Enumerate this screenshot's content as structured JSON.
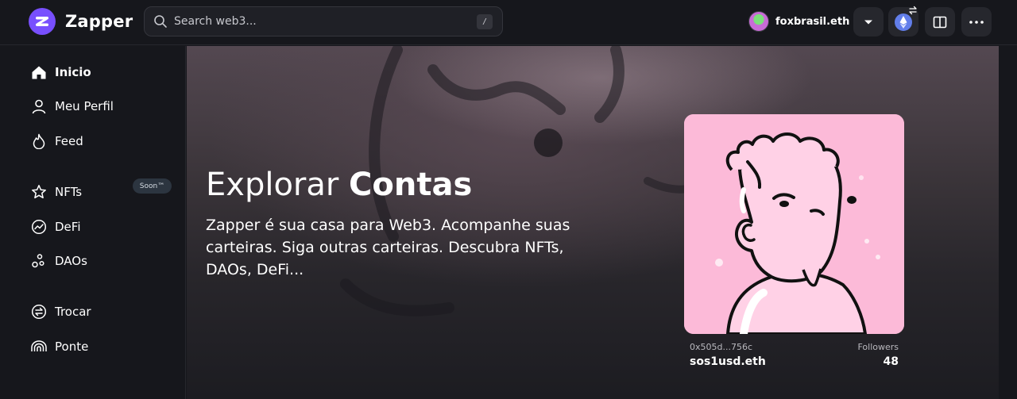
{
  "brand": {
    "name": "Zapper",
    "accent": "#784ffe"
  },
  "search": {
    "placeholder": "Search web3...",
    "shortcut": "/"
  },
  "account": {
    "name": "foxbrasil.eth"
  },
  "toolbar": {
    "dropdown_icon": "chevron-down-icon",
    "network_icon": "ethereum-icon",
    "panel_icon": "book-open-icon",
    "more_icon": "more-horizontal-icon"
  },
  "sidebar": {
    "items": [
      {
        "label": "Inicio",
        "icon": "home-icon",
        "active": true
      },
      {
        "label": "Meu Perfil",
        "icon": "user-icon"
      },
      {
        "label": "Feed",
        "icon": "flame-icon",
        "badge": "Soon™"
      },
      {
        "label": "NFTs",
        "icon": "star-icon"
      },
      {
        "label": "DeFi",
        "icon": "trend-icon"
      },
      {
        "label": "DAOs",
        "icon": "dao-icon"
      },
      {
        "label": "Trocar",
        "icon": "swap-icon"
      },
      {
        "label": "Ponte",
        "icon": "bridge-icon"
      }
    ]
  },
  "hero": {
    "title_light": "Explorar ",
    "title_bold": "Contas",
    "description": "Zapper é sua casa para Web3. Acompanhe suas carteiras. Siga outras carteiras. Descubra NFTs, DAOs, DeFi..."
  },
  "card": {
    "address": "0x505d...756c",
    "ens": "sos1usd.eth",
    "followers_label": "Followers",
    "followers_count": "48"
  }
}
